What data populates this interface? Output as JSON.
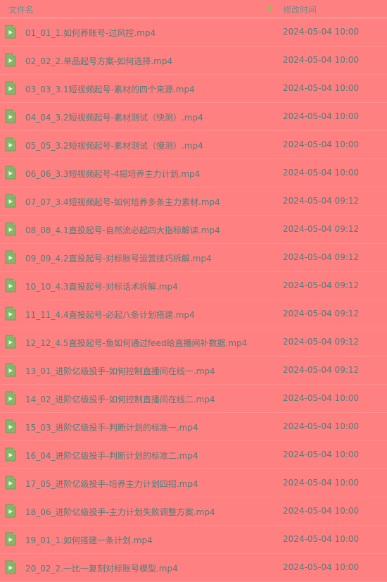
{
  "header": {
    "name_label": "文件名",
    "time_label": "修改时间",
    "sort_icon": "sort-up-arrow-icon"
  },
  "colors": {
    "background": "#ff8080",
    "text": "#4f7f7c",
    "header_text": "#6f8f8d",
    "video_icon": "#86b46a",
    "sort_arrow": "#8fc25c"
  },
  "files": [
    {
      "name": "01_01_1.如何养账号-过风控.mp4",
      "time": "2024-05-04 10:00"
    },
    {
      "name": "02_02_2.单品起号方案-如何选择.mp4",
      "time": "2024-05-04 10:00"
    },
    {
      "name": "03_03_3.1短视频起号-素材的四个来源.mp4",
      "time": "2024-05-04 10:00"
    },
    {
      "name": "04_04_3.2短视频起号-素材测试（快测）.mp4",
      "time": "2024-05-04 10:00"
    },
    {
      "name": "05_05_3.2短视频起号-素材测试（慢测）.mp4",
      "time": "2024-05-04 10:00"
    },
    {
      "name": "06_06_3.3短视频起号-4招培养主力计划.mp4",
      "time": "2024-05-04 10:00"
    },
    {
      "name": "07_07_3.4短视频起号-如何培养多条主力素材.mp4",
      "time": "2024-05-04 09:12"
    },
    {
      "name": "08_08_4.1直投起号-自然流必起四大指标解读.mp4",
      "time": "2024-05-04 09:12"
    },
    {
      "name": "09_09_4.2直投起号-对标账号运营技巧拆解.mp4",
      "time": "2024-05-04 09:12"
    },
    {
      "name": "10_10_4.3直投起号-对标话术拆解.mp4",
      "time": "2024-05-04 09:12"
    },
    {
      "name": "11_11_4.4直投起号-必起八条计划搭建.mp4",
      "time": "2024-05-04 09:12"
    },
    {
      "name": "12_12_4.5直投起号-鱼如何通过feed给直播间补数据.mp4",
      "time": "2024-05-04 09:12"
    },
    {
      "name": "13_01_进阶亿级投手-如何控制直播间在线一.mp4",
      "time": "2024-05-04 09:12"
    },
    {
      "name": "14_02_进阶亿级投手-如何控制直播间在线二.mp4",
      "time": "2024-05-04 10:00"
    },
    {
      "name": "15_03_进阶亿级投手-判断计划的标准一.mp4",
      "time": "2024-05-04 10:00"
    },
    {
      "name": "16_04_进阶亿级投手-判断计划的标准二.mp4",
      "time": "2024-05-04 10:00"
    },
    {
      "name": "17_05_进阶亿级投手-培养主力计划四招.mp4",
      "time": "2024-05-04 10:00"
    },
    {
      "name": "18_06_进阶亿级投手-主力计划失败调整方案.mp4",
      "time": "2024-05-04 10:00"
    },
    {
      "name": "19_01_1.如何搭建一条计划.mp4",
      "time": "2024-05-04 10:00"
    },
    {
      "name": "20_02_2.一比一复刻对标账号模型.mp4",
      "time": "2024-05-04 10:00"
    }
  ]
}
